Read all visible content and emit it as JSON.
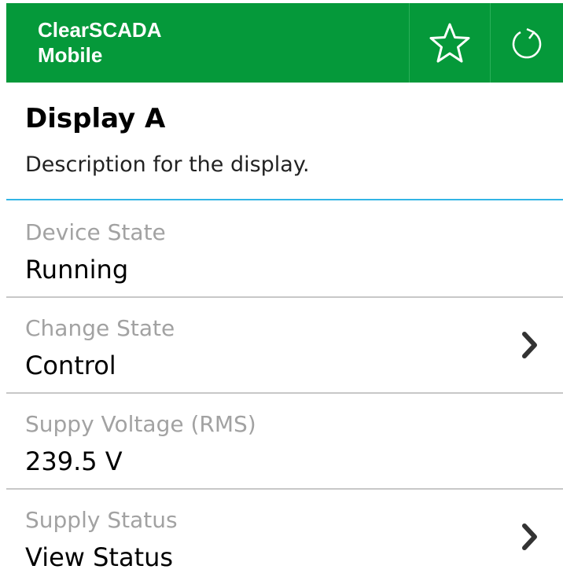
{
  "app": {
    "title_line1": "ClearSCADA",
    "title_line2": "Mobile",
    "icons": {
      "favorite": "star-outline-icon",
      "refresh": "refresh-icon"
    },
    "colors": {
      "bar": "#05993a",
      "divider_accent": "#33b5e5"
    }
  },
  "display": {
    "title": "Display A",
    "description": "Description for the display."
  },
  "rows": [
    {
      "label": "Device State",
      "value": "Running",
      "has_chevron": false
    },
    {
      "label": "Change State",
      "value": "Control",
      "has_chevron": true
    },
    {
      "label": "Suppy Voltage (RMS)",
      "value": "239.5 V",
      "has_chevron": false
    },
    {
      "label": "Supply Status",
      "value": "View Status",
      "has_chevron": true
    }
  ]
}
